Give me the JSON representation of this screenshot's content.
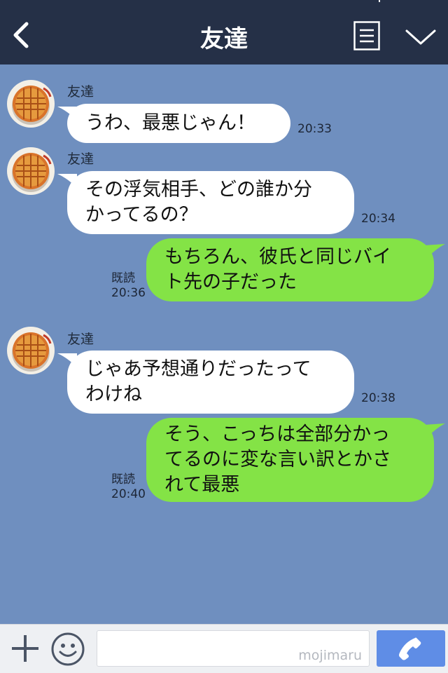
{
  "header": {
    "title": "友達",
    "back_icon": "chevron-left-icon",
    "menu_icon": "list-icon",
    "collapse_icon": "chevron-down-icon"
  },
  "messages": [
    {
      "side": "left",
      "sender": "友達",
      "lines": [
        "うわ、最悪じゃん！"
      ],
      "time": "20:33"
    },
    {
      "side": "left",
      "sender": "友達",
      "lines": [
        "その浮気相手、どの誰か分",
        "かってるの？"
      ],
      "time": "20:34"
    },
    {
      "side": "right",
      "lines": [
        "もちろん、彼氏と同じバイ",
        "ト先の子だった"
      ],
      "read": "既読",
      "time": "20:36"
    },
    {
      "side": "left",
      "sender": "友達",
      "lines": [
        "じゃあ予想通りだったって",
        "わけね"
      ],
      "time": "20:38"
    },
    {
      "side": "right",
      "lines": [
        "そう、こっちは全部分かっ",
        "てるのに変な言い訳とかさ",
        "れて最悪"
      ],
      "read": "既読",
      "time": "20:40"
    }
  ],
  "input_bar": {
    "placeholder": "",
    "watermark": "mojimaru",
    "plus_icon": "plus-icon",
    "emoji_icon": "smile-icon",
    "call_icon": "phone-icon"
  },
  "colors": {
    "header_bg": "#253047",
    "chat_bg": "#6f8fbf",
    "left_bubble": "#ffffff",
    "right_bubble": "#84e346",
    "call_button": "#5f8de6"
  }
}
